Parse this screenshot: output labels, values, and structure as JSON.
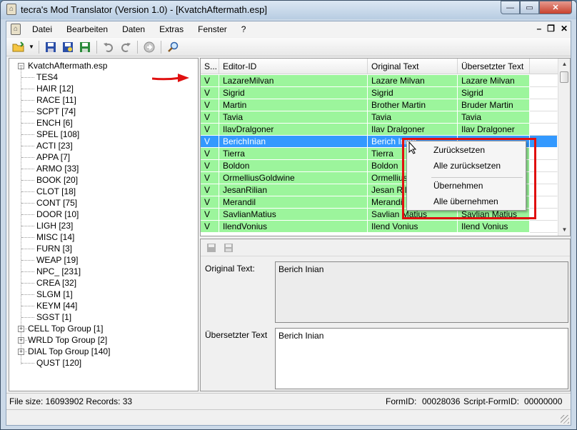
{
  "window": {
    "title": "tecra's Mod Translator (Version 1.0) - [KvatchAftermath.esp]",
    "close_label": "✕",
    "max_label": "▭",
    "min_label": "—"
  },
  "menu": {
    "items": [
      "Datei",
      "Bearbeiten",
      "Daten",
      "Extras",
      "Fenster",
      "?"
    ],
    "mdi_min": "–",
    "mdi_restore": "❐",
    "mdi_close": "✕"
  },
  "toolbar": {
    "icons": [
      "open-folder-icon",
      "dropdown-arrow-icon",
      "save-icon",
      "save-as-icon",
      "save-green-icon",
      "undo-icon",
      "redo-icon",
      "forward-circle-icon",
      "search-icon"
    ]
  },
  "tree": {
    "root": "KvatchAftermath.esp",
    "items": [
      {
        "label": "TES4",
        "expandable": false
      },
      {
        "label": "HAIR [12]",
        "expandable": false
      },
      {
        "label": "RACE [11]",
        "expandable": false
      },
      {
        "label": "SCPT [74]",
        "expandable": false
      },
      {
        "label": "ENCH [6]",
        "expandable": false
      },
      {
        "label": "SPEL [108]",
        "expandable": false
      },
      {
        "label": "ACTI [23]",
        "expandable": false
      },
      {
        "label": "APPA [7]",
        "expandable": false
      },
      {
        "label": "ARMO [33]",
        "expandable": false
      },
      {
        "label": "BOOK [20]",
        "expandable": false
      },
      {
        "label": "CLOT [18]",
        "expandable": false
      },
      {
        "label": "CONT [75]",
        "expandable": false
      },
      {
        "label": "DOOR [10]",
        "expandable": false
      },
      {
        "label": "LIGH [23]",
        "expandable": false
      },
      {
        "label": "MISC [14]",
        "expandable": false
      },
      {
        "label": "FURN [3]",
        "expandable": false
      },
      {
        "label": "WEAP [19]",
        "expandable": false
      },
      {
        "label": "NPC_ [231]",
        "expandable": false
      },
      {
        "label": "CREA [32]",
        "expandable": false
      },
      {
        "label": "SLGM [1]",
        "expandable": false
      },
      {
        "label": "KEYM [44]",
        "expandable": false
      },
      {
        "label": "SGST [1]",
        "expandable": false
      },
      {
        "label": "CELL Top Group [1]",
        "expandable": true
      },
      {
        "label": "WRLD Top Group [2]",
        "expandable": true
      },
      {
        "label": "DIAL Top Group [140]",
        "expandable": true
      },
      {
        "label": "QUST [120]",
        "expandable": false
      }
    ]
  },
  "grid": {
    "headers": [
      "S...",
      "Editor-ID",
      "Original Text",
      "Übersetzter Text"
    ],
    "selected_index": 5,
    "rows": [
      {
        "status": "V",
        "editor_id": "LazareMilvan",
        "original": "Lazare Milvan",
        "translated": "Lazare Milvan"
      },
      {
        "status": "V",
        "editor_id": "Sigrid",
        "original": "Sigrid",
        "translated": "Sigrid"
      },
      {
        "status": "V",
        "editor_id": "Martin",
        "original": "Brother Martin",
        "translated": "Bruder Martin"
      },
      {
        "status": "V",
        "editor_id": "Tavia",
        "original": "Tavia",
        "translated": "Tavia"
      },
      {
        "status": "V",
        "editor_id": "IlavDralgoner",
        "original": "Ilav Dralgoner",
        "translated": "Ilav Dralgoner"
      },
      {
        "status": "V",
        "editor_id": "BerichInian",
        "original": "Berich Inian",
        "translated": ""
      },
      {
        "status": "V",
        "editor_id": "Tierra",
        "original": "Tierra",
        "translated": ""
      },
      {
        "status": "V",
        "editor_id": "Boldon",
        "original": "Boldon",
        "translated": ""
      },
      {
        "status": "V",
        "editor_id": "OrmelliusGoldwine",
        "original": "Ormellius G",
        "translated": ""
      },
      {
        "status": "V",
        "editor_id": "JesanRilian",
        "original": "Jesan Rilian",
        "translated": ""
      },
      {
        "status": "V",
        "editor_id": "Merandil",
        "original": "Merandil",
        "translated": ""
      },
      {
        "status": "V",
        "editor_id": "SavlianMatius",
        "original": "Savlian Matius",
        "translated": "Savlian Matius"
      },
      {
        "status": "V",
        "editor_id": "IlendVonius",
        "original": "Ilend Vonius",
        "translated": "Ilend Vonius"
      }
    ]
  },
  "context_menu": {
    "items": [
      "Zurücksetzen",
      "Alle zurücksetzen",
      "Übernehmen",
      "Alle übernehmen"
    ]
  },
  "detail": {
    "original_label": "Original Text:",
    "original_value": "Berich Inian",
    "translated_label": "Übersetzter Text",
    "translated_value": "Berich Inian"
  },
  "status": {
    "file_info": "File size: 16093902 Records: 33",
    "form_id_label": "FormID:",
    "form_id_value": "00028036",
    "script_form_id_label": "Script-FormID:",
    "script_form_id_value": "00000000"
  },
  "colors": {
    "row_green": "#9cf59c",
    "row_selected": "#3399ff",
    "highlight_red": "#e01010"
  }
}
